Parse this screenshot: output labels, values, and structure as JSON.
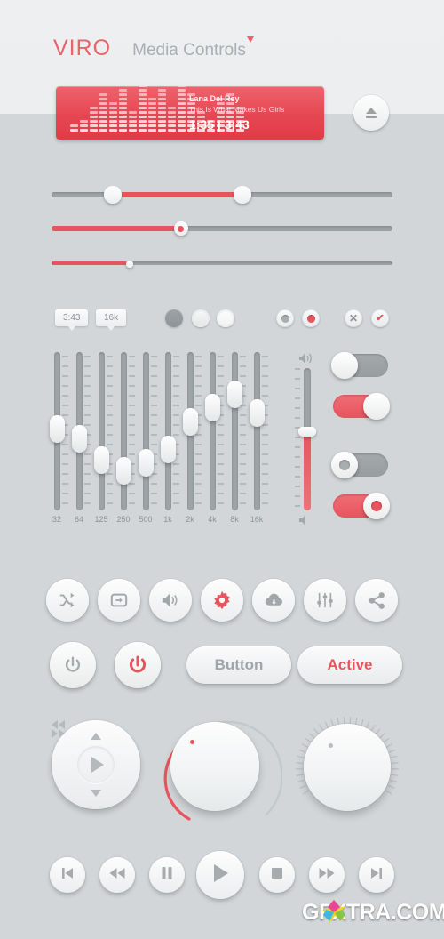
{
  "header": {
    "brand": "VIRO",
    "subtitle": "Media Controls"
  },
  "player": {
    "artist": "Lana Del Rey",
    "song": "This Is What Makes Us Girls",
    "time": "1:35 | 3:43",
    "eject_icon": "eject-icon",
    "visualizer_levels": [
      2,
      3,
      6,
      9,
      7,
      10,
      5,
      12,
      8,
      10,
      6,
      13,
      9,
      5,
      3,
      8,
      9,
      6
    ]
  },
  "sliders": [
    {
      "name": "range-slider",
      "fill_start_pct": 18,
      "fill_end_pct": 56,
      "value_low": 18,
      "value_high": 56
    },
    {
      "name": "value-slider",
      "fill_end_pct": 38,
      "value": 38
    },
    {
      "name": "thin-slider",
      "fill_end_pct": 23,
      "value": 23
    }
  ],
  "tooltips": [
    {
      "label": "3:43"
    },
    {
      "label": "16k"
    }
  ],
  "circle_buttons": [
    {
      "name": "solid-circle-button",
      "style": "plain"
    },
    {
      "name": "ring-circle-button",
      "style": "ring"
    },
    {
      "name": "light-circle-button",
      "style": "ring2"
    }
  ],
  "radios": [
    {
      "name": "radio-inactive",
      "state": "gray"
    },
    {
      "name": "radio-active",
      "state": "red"
    }
  ],
  "confirm_buttons": [
    {
      "name": "cancel-x-button",
      "glyph": "✕"
    },
    {
      "name": "confirm-check-button",
      "glyph": "✔"
    }
  ],
  "equalizer": {
    "bands": [
      {
        "label": "32",
        "value": 52
      },
      {
        "label": "64",
        "value": 44
      },
      {
        "label": "125",
        "value": 28
      },
      {
        "label": "250",
        "value": 20
      },
      {
        "label": "500",
        "value": 26
      },
      {
        "label": "1k",
        "value": 36
      },
      {
        "label": "2k",
        "value": 57
      },
      {
        "label": "4k",
        "value": 68
      },
      {
        "label": "8k",
        "value": 78
      },
      {
        "label": "16k",
        "value": 64
      }
    ]
  },
  "volume_slider": {
    "name": "vertical-volume-slider",
    "value": 56,
    "icon_top": "volume-high-icon",
    "icon_bottom": "volume-mute-icon"
  },
  "toggles": [
    {
      "name": "toggle-off-plain",
      "state": "off",
      "has_inner": false
    },
    {
      "name": "toggle-on-plain",
      "state": "on",
      "has_inner": false
    },
    {
      "name": "toggle-off-dot",
      "state": "off",
      "has_inner": true
    },
    {
      "name": "toggle-on-dot",
      "state": "on",
      "has_inner": true
    }
  ],
  "icon_buttons": [
    {
      "name": "shuffle-button",
      "icon": "shuffle-icon",
      "accent": false
    },
    {
      "name": "repeat-button",
      "icon": "repeat-icon",
      "accent": false
    },
    {
      "name": "volume-button",
      "icon": "speaker-icon",
      "accent": false
    },
    {
      "name": "settings-button",
      "icon": "gear-icon",
      "accent": true
    },
    {
      "name": "cloud-download-button",
      "icon": "cloud-download-icon",
      "accent": false
    },
    {
      "name": "equalizer-button",
      "icon": "sliders-icon",
      "accent": false
    },
    {
      "name": "share-button",
      "icon": "share-icon",
      "accent": false
    }
  ],
  "power_row": {
    "power_off": {
      "name": "power-button-inactive",
      "icon": "power-icon",
      "accent": false
    },
    "power_on": {
      "name": "power-button-active",
      "icon": "power-icon",
      "accent": true
    },
    "button_normal": "Button",
    "button_active": "Active"
  },
  "dpad": {
    "name": "directional-pad",
    "up": "up-arrow-icon",
    "down": "down-arrow-icon",
    "left": "rewind-icon",
    "right": "fast-forward-icon",
    "center": "play-icon"
  },
  "knobs": [
    {
      "name": "rotary-knob-with-arc",
      "arc_color": "#e8545e",
      "marker_color": "#e8545e",
      "value": 28
    },
    {
      "name": "rotary-knob-ticks",
      "marker_color": "#b8bdc0",
      "value": 30
    }
  ],
  "transport": [
    {
      "name": "previous-track-button",
      "icon": "skip-previous-icon",
      "size": "sm"
    },
    {
      "name": "rewind-button",
      "icon": "rewind-icon",
      "size": "sm"
    },
    {
      "name": "pause-button",
      "icon": "pause-icon",
      "size": "sm"
    },
    {
      "name": "play-button",
      "icon": "play-icon",
      "size": "lg"
    },
    {
      "name": "stop-button",
      "icon": "stop-icon",
      "size": "sm"
    },
    {
      "name": "fast-forward-button",
      "icon": "fast-forward-icon",
      "size": "sm"
    },
    {
      "name": "next-track-button",
      "icon": "skip-next-icon",
      "size": "sm"
    }
  ],
  "watermark": {
    "text_left": "GF",
    "text_right": "TRA.COM",
    "full": "GFXTRA.COM"
  },
  "colors": {
    "accent_red": "#e8545e",
    "header_bg": "#eceeef",
    "body_bg": "#d2d6d8",
    "track_gray": "#9ea3a6",
    "text_gray": "#8f9498"
  }
}
